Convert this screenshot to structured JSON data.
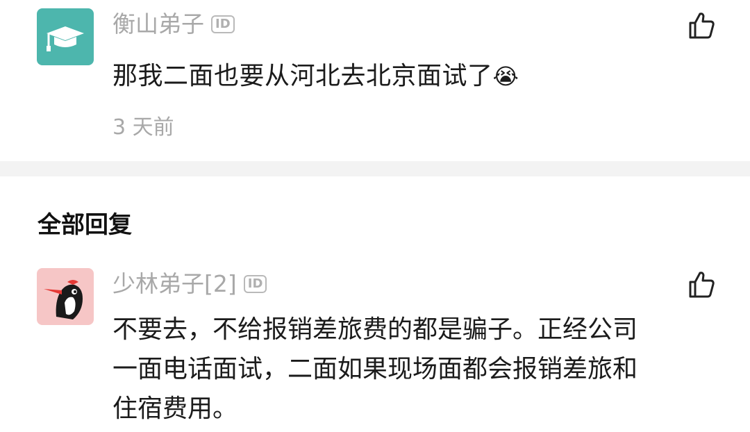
{
  "comment_1": {
    "username": "衡山弟子",
    "id_badge": "ID",
    "text": "那我二面也要从河北去北京面试了",
    "emoji": "😭",
    "timestamp": "3 天前",
    "avatar_color": "#4db6ad",
    "avatar_icon": "graduation-cap-icon"
  },
  "section": {
    "title": "全部回复"
  },
  "reply_1": {
    "username": "少林弟子[2]",
    "id_badge": "ID",
    "lines": [
      "不要去，不给报销差旅费的都是骗子。正经公司",
      "一面电话面试，二面如果现场面都会报销差旅和",
      "住宿费用。"
    ],
    "avatar_color": "#f6c6c6",
    "avatar_icon": "woodpecker-icon"
  },
  "colors": {
    "username": "#a8a8a8",
    "text": "#1b1b1b",
    "divider": "#f3f3f3"
  }
}
